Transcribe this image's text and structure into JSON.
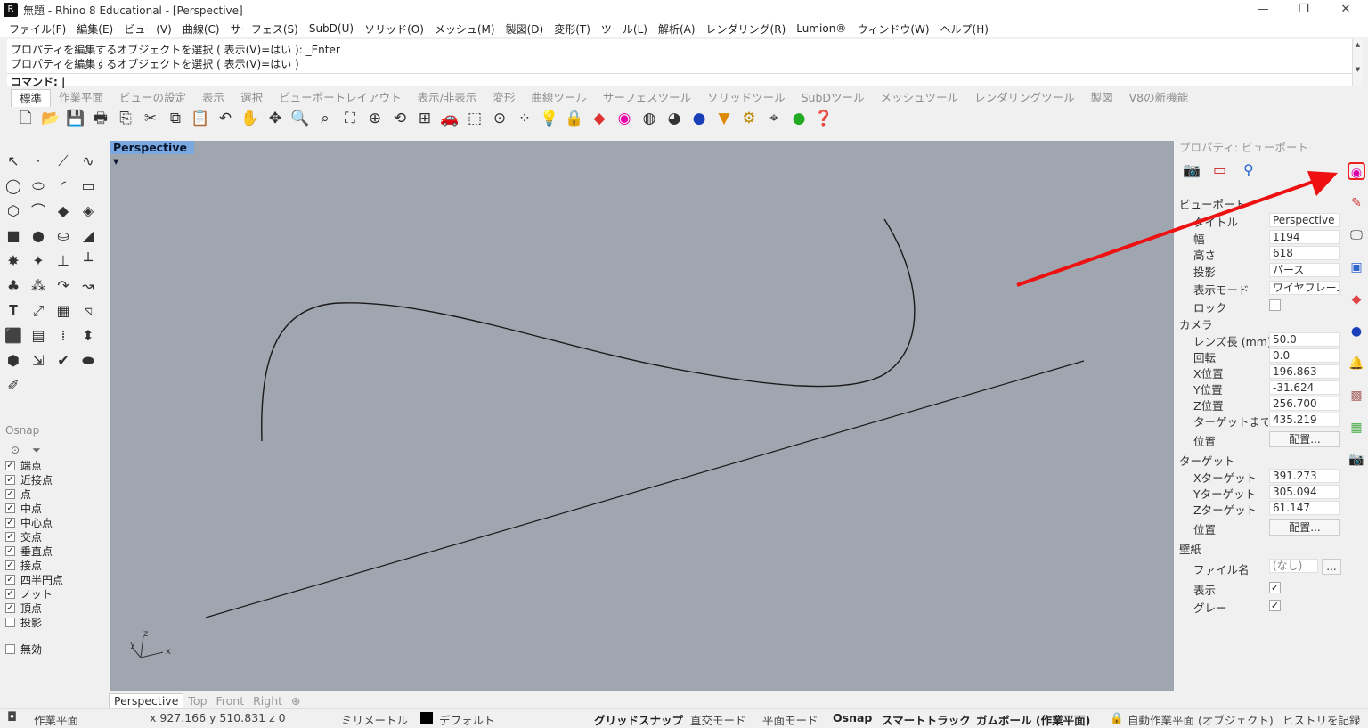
{
  "app": {
    "title": "無題 - Rhino 8 Educational - [Perspective]",
    "logo_icon": "rhino-logo-icon",
    "window_controls": [
      "—",
      "❐",
      "✕"
    ]
  },
  "menu": [
    "ファイル(F)",
    "編集(E)",
    "ビュー(V)",
    "曲線(C)",
    "サーフェス(S)",
    "SubD(U)",
    "ソリッド(O)",
    "メッシュ(M)",
    "製図(D)",
    "変形(T)",
    "ツール(L)",
    "解析(A)",
    "レンダリング(R)",
    "Lumion®",
    "ウィンドウ(W)",
    "ヘルプ(H)"
  ],
  "command": {
    "history": [
      "プロパティを編集するオブジェクトを選択 ( 表示(V)=はい ): _Enter",
      "プロパティを編集するオブジェクトを選択 ( 表示(V)=はい )"
    ],
    "prompt": "コマンド: |"
  },
  "toolbar_tabs": [
    "標準",
    "作業平面",
    "ビューの設定",
    "表示",
    "選択",
    "ビューポートレイアウト",
    "表示/非表示",
    "変形",
    "曲線ツール",
    "サーフェスツール",
    "ソリッドツール",
    "SubDツール",
    "メッシュツール",
    "レンダリングツール",
    "製図",
    "V8の新機能"
  ],
  "toolbar_icons": [
    "new-file-icon",
    "open-icon",
    "save-icon",
    "print-icon",
    "import-icon",
    "cut-icon",
    "copy-icon",
    "paste-icon",
    "undo-icon",
    "pan-icon",
    "rotate-view-icon",
    "zoom-icon",
    "zoom-window-icon",
    "zoom-extents-icon",
    "zoom-selected-icon",
    "rotate-icon",
    "four-viewports-icon",
    "car-icon",
    "cplane-icon",
    "osnap-icon",
    "select-points-icon",
    "light-icon",
    "lock-icon",
    "layer-icon",
    "color-wheel-icon",
    "wireframe-sphere-icon",
    "shaded-sphere-icon",
    "rendered-sphere-icon",
    "selection-filter-icon",
    "settings-icon",
    "gumball-icon",
    "grasshopper-icon",
    "help-icon"
  ],
  "viewport": {
    "tab_label": "Perspective",
    "axis_x": "x",
    "axis_y": "y",
    "axis_z": "z"
  },
  "viewport_tabs": [
    "Perspective",
    "Top",
    "Front",
    "Right",
    "⊕"
  ],
  "osnap": {
    "title": "Osnap",
    "items": [
      {
        "label": "端点",
        "checked": true
      },
      {
        "label": "近接点",
        "checked": true
      },
      {
        "label": "点",
        "checked": true
      },
      {
        "label": "中点",
        "checked": true
      },
      {
        "label": "中心点",
        "checked": true
      },
      {
        "label": "交点",
        "checked": true
      },
      {
        "label": "垂直点",
        "checked": true
      },
      {
        "label": "接点",
        "checked": true
      },
      {
        "label": "四半円点",
        "checked": true
      },
      {
        "label": "ノット",
        "checked": true
      },
      {
        "label": "頂点",
        "checked": true
      },
      {
        "label": "投影",
        "checked": false
      }
    ],
    "disable": {
      "label": "無効",
      "checked": false
    }
  },
  "properties": {
    "title": "プロパティ: ビューポート",
    "viewport_section": "ビューポート",
    "rows": [
      {
        "label": "タイトル",
        "value": "Perspective"
      },
      {
        "label": "幅",
        "value": "1194"
      },
      {
        "label": "高さ",
        "value": "618"
      },
      {
        "label": "投影",
        "value": "パース"
      },
      {
        "label": "表示モード",
        "value": "ワイヤフレーム"
      },
      {
        "label": "ロック",
        "value": ""
      }
    ],
    "camera_section": "カメラ",
    "camera_rows": [
      {
        "label": "レンズ長 (mm)",
        "value": "50.0"
      },
      {
        "label": "回転",
        "value": "0.0"
      },
      {
        "label": "X位置",
        "value": "196.863"
      },
      {
        "label": "Y位置",
        "value": "-31.624"
      },
      {
        "label": "Z位置",
        "value": "256.700"
      },
      {
        "label": "ターゲットまでの距離",
        "value": "435.219"
      }
    ],
    "position_label": "位置",
    "place_button": "配置...",
    "target_section": "ターゲット",
    "target_rows": [
      {
        "label": "Xターゲット",
        "value": "391.273"
      },
      {
        "label": "Yターゲット",
        "value": "305.094"
      },
      {
        "label": "Zターゲット",
        "value": "61.147"
      }
    ],
    "wallpaper_section": "壁紙",
    "filename_label": "ファイル名",
    "filename_value": "(なし)",
    "browse_button": "...",
    "show_label": "表示",
    "gray_label": "グレー"
  },
  "right_strip_icons": [
    "color-wheel-icon",
    "material-brush-icon",
    "display-monitor-icon",
    "named-views-icon",
    "layers-icon",
    "render-sphere-icon",
    "bell-icon",
    "texture-icon",
    "environment-icon",
    "camera-icon"
  ],
  "status": {
    "cplane": "作業平面",
    "coords": "x 927.166  y 510.831  z 0",
    "units": "ミリメートル",
    "layer": "デフォルト",
    "grid_snap": "グリッドスナップ",
    "ortho": "直交モード",
    "planar": "平面モード",
    "osnap": "Osnap",
    "smarttrack": "スマートトラック",
    "gumball": "ガムボール (作業平面)",
    "auto_cplane": "自動作業平面 (オブジェクト)",
    "history": "ヒストリを記録"
  },
  "colors": {
    "viewport_bg": "#9fa6b0",
    "annotation_arrow": "#ee1111",
    "viewport_tab": "#7aa7e0"
  }
}
